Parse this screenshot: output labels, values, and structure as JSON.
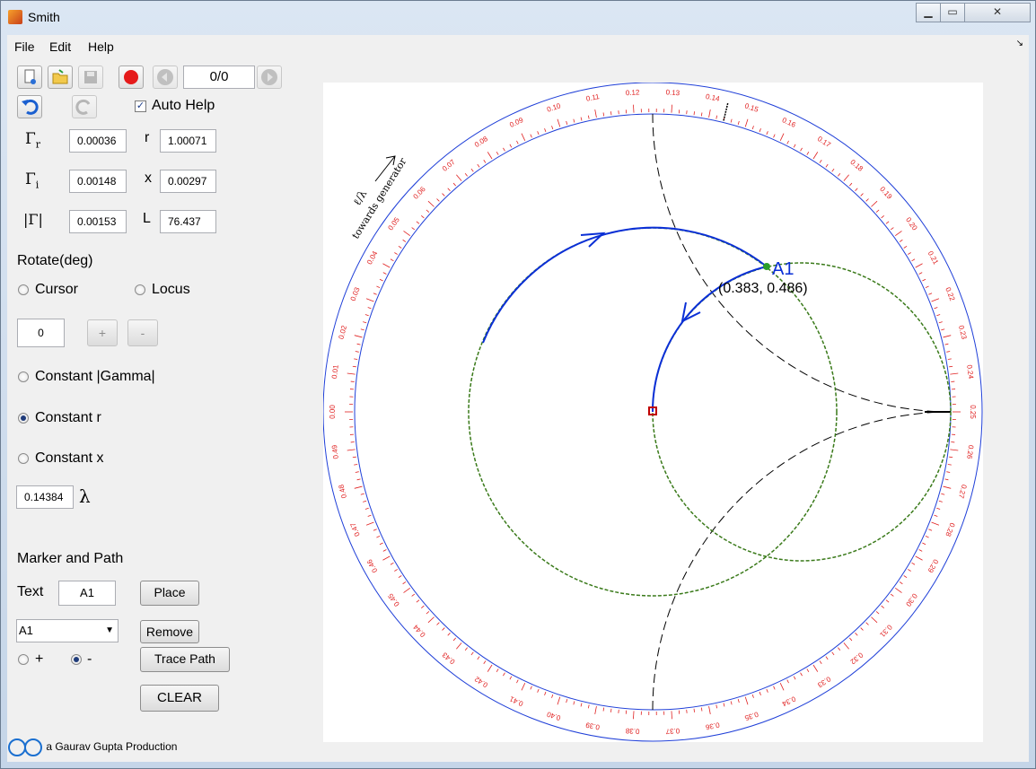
{
  "window": {
    "title": "Smith",
    "controls": [
      "minimize",
      "maximize",
      "close"
    ]
  },
  "menu": [
    "File",
    "Edit",
    "Help"
  ],
  "toolbar": {
    "frame_counter": "0/0"
  },
  "auto_help": {
    "label": "Auto Help",
    "checked": true
  },
  "readouts": {
    "gamma_r_label": "Γ",
    "gamma_r_sub": "r",
    "gamma_r": "0.00036",
    "r_label": "r",
    "r": "1.00071",
    "gamma_i_label": "Γ",
    "gamma_i_sub": "i",
    "gamma_i": "0.00148",
    "x_label": "x",
    "x": "0.00297",
    "abs_gamma_label": "|Γ|",
    "abs_gamma": "0.00153",
    "L_label": "L",
    "L": "76.437"
  },
  "rotate": {
    "heading": "Rotate(deg)",
    "cursor_label": "Cursor",
    "locus_label": "Locus",
    "value": "0",
    "plus": "+",
    "minus": "-"
  },
  "modes": {
    "constant_gamma": "Constant |Gamma|",
    "constant_r": "Constant r",
    "constant_x": "Constant x",
    "selected": "constant_r"
  },
  "lambda": {
    "value": "0.14384",
    "symbol": "λ"
  },
  "marker": {
    "heading": "Marker and Path",
    "text_label": "Text",
    "text_value": "A1",
    "place": "Place",
    "selected": "A1",
    "remove": "Remove",
    "trace_path": "Trace Path",
    "plus_label": "+",
    "minus_label": "-",
    "clear": "CLEAR"
  },
  "credit": "a Gaurav Gupta Production",
  "chart": {
    "marker_label": "A1",
    "marker_coords": "(0.383, 0.486)",
    "scale_caption_1": "ℓ/λ",
    "scale_caption_2": "towards generator",
    "colors": {
      "outer_circle": "#1f3fd8",
      "scale_text": "#e02020",
      "path": "#0a2fd6",
      "locus": "#3a7a1a",
      "reference": "#000000",
      "center_marker": "#c00000"
    }
  }
}
